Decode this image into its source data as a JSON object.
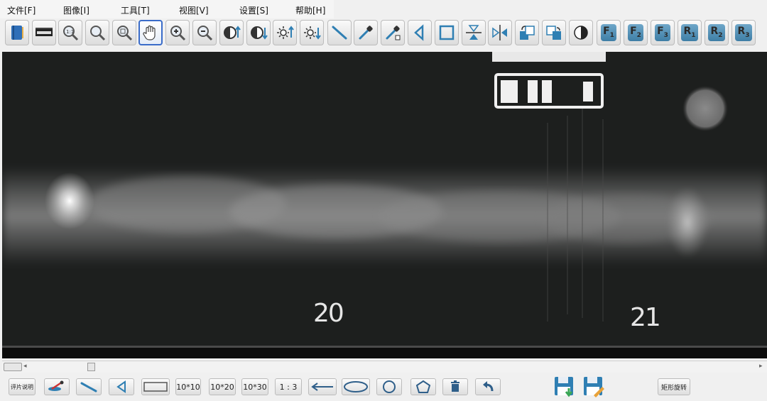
{
  "menu": {
    "items": [
      "文件[F]",
      "图像[I]",
      "工具[T]",
      "视图[V]",
      "设置[S]",
      "帮助[H]"
    ]
  },
  "toolbar": {
    "buttons": [
      {
        "icon": "book-icon"
      },
      {
        "icon": "film-strip-icon"
      },
      {
        "icon": "zoom-fit-icon"
      },
      {
        "icon": "zoom-icon"
      },
      {
        "icon": "zoom-reset-icon"
      },
      {
        "icon": "hand-pan-icon",
        "active": true
      },
      {
        "icon": "zoom-in-icon"
      },
      {
        "icon": "zoom-out-icon"
      },
      {
        "icon": "contrast-up-icon"
      },
      {
        "icon": "contrast-down-icon"
      },
      {
        "icon": "brightness-up-icon"
      },
      {
        "icon": "brightness-down-icon"
      },
      {
        "icon": "line-tool-icon"
      },
      {
        "icon": "eyedropper-icon"
      },
      {
        "icon": "eyedropper-edit-icon"
      },
      {
        "icon": "triangle-left-icon"
      },
      {
        "icon": "rectangle-icon"
      },
      {
        "icon": "flip-vertical-icon"
      },
      {
        "icon": "flip-horizontal-icon"
      },
      {
        "icon": "rotate-left-icon"
      },
      {
        "icon": "rotate-right-icon"
      },
      {
        "icon": "invert-icon"
      },
      {
        "icon": "f1-icon",
        "label": "F",
        "sub": "1"
      },
      {
        "icon": "f2-icon",
        "label": "F",
        "sub": "2"
      },
      {
        "icon": "f3-icon",
        "label": "F",
        "sub": "3"
      },
      {
        "icon": "r1-icon",
        "label": "R",
        "sub": "1"
      },
      {
        "icon": "r2-icon",
        "label": "R",
        "sub": "2"
      },
      {
        "icon": "r3-icon",
        "label": "R",
        "sub": "3"
      }
    ]
  },
  "viewer": {
    "markers": [
      "20",
      "21"
    ]
  },
  "bottom": {
    "review_label": "评片说明",
    "grid_10x10": "10*10",
    "grid_10x20": "10*20",
    "grid_10x30": "10*30",
    "ratio": "1 : 3",
    "rect_rotate_label": "矩形旋转"
  },
  "colors": {
    "accent": "#3a6cc9",
    "icon_blue": "#2f7fb3",
    "save_green": "#3aa655",
    "film_background": "#1d1f1e"
  }
}
